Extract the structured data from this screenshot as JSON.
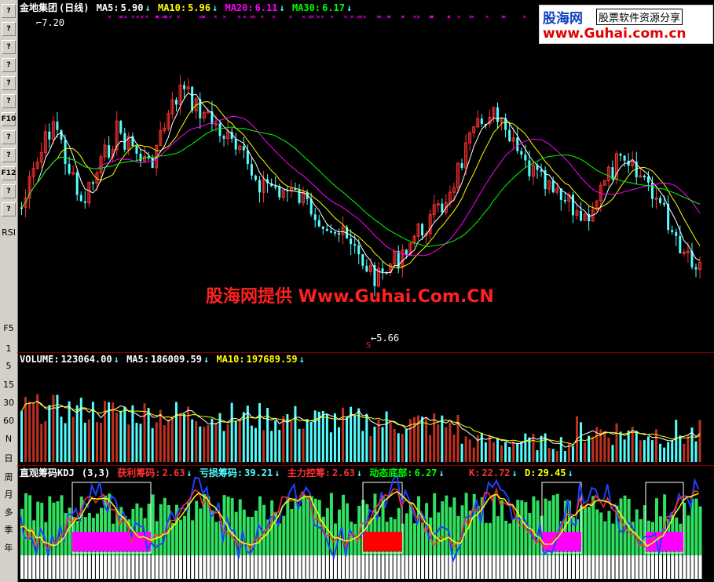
{
  "toolbar": {
    "buttons": [
      "?",
      "?",
      "?",
      "?",
      "?",
      "?",
      "F10",
      "?",
      "?",
      "F12",
      "?",
      "?"
    ],
    "labels": [
      "RSI",
      "F5",
      "1",
      "5",
      "15",
      "30",
      "60",
      "N",
      "日",
      "周",
      "月",
      "多",
      "季",
      "年"
    ]
  },
  "price_panel": {
    "stock_name": "金地集团",
    "period": "(日线)",
    "ma5_label": "MA5:",
    "ma5_value": "5.90",
    "ma10_label": "MA10:",
    "ma10_value": "5.96",
    "ma20_label": "MA20:",
    "ma20_value": "6.11",
    "ma30_label": "MA30:",
    "ma30_value": "6.17",
    "high_mark": "7.20",
    "low_mark": "5.66",
    "s_mark": "S",
    "colors": {
      "ma5": "#ffffff",
      "ma10": "#ffff00",
      "ma20": "#ff00ff",
      "ma30": "#00ff00",
      "up": "#ff3030",
      "down": "#54ffff"
    }
  },
  "volume_panel": {
    "vol_label": "VOLUME:",
    "vol_value": "123064.00",
    "ma5_label": "MA5:",
    "ma5_value": "186009.59",
    "ma10_label": "MA10:",
    "ma10_value": "197689.59"
  },
  "indicator_panel": {
    "name": "直观筹码KDJ",
    "params": "(3,3)",
    "profit_label": "获利筹码:",
    "profit_value": "2.63",
    "loss_label": "亏损筹码:",
    "loss_value": "39.21",
    "main_label": "主力控筹:",
    "main_value": "2.63",
    "bottom_label": "动态底部:",
    "bottom_value": "6.27",
    "k_label": "K:",
    "k_value": "22.72",
    "d_label": "D:",
    "d_value": "29.45"
  },
  "logo": {
    "brand": "股海网",
    "tagline": "股票软件资源分享",
    "url": "www.Guhai.com.cn"
  },
  "watermark": "股海网提供 Www.Guhai.Com.CN"
}
